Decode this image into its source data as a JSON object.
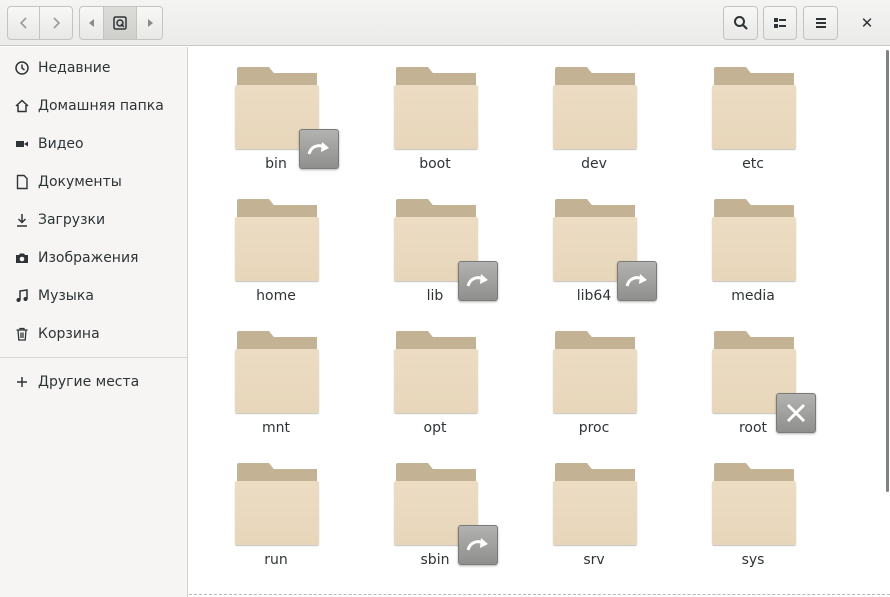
{
  "header": {
    "back_icon": "chevron-left-icon",
    "forward_icon": "chevron-right-icon",
    "path_prev_icon": "triangle-left-icon",
    "path_root_icon": "drive-icon",
    "path_next_icon": "triangle-right-icon",
    "search_icon": "search-icon",
    "view_icon": "list-view-icon",
    "menu_icon": "hamburger-menu-icon",
    "close_label": "✕"
  },
  "sidebar": {
    "items": [
      {
        "label": "Недавние",
        "icon": "clock-icon"
      },
      {
        "label": "Домашняя папка",
        "icon": "home-icon"
      },
      {
        "label": "Видео",
        "icon": "video-icon"
      },
      {
        "label": "Документы",
        "icon": "document-icon"
      },
      {
        "label": "Загрузки",
        "icon": "download-icon"
      },
      {
        "label": "Изображения",
        "icon": "camera-icon"
      },
      {
        "label": "Музыка",
        "icon": "music-icon"
      },
      {
        "label": "Корзина",
        "icon": "trash-icon"
      }
    ],
    "other": {
      "label": "Другие места",
      "icon": "plus-icon"
    }
  },
  "folders": [
    {
      "name": "bin",
      "emblem": "symlink"
    },
    {
      "name": "boot",
      "emblem": ""
    },
    {
      "name": "dev",
      "emblem": ""
    },
    {
      "name": "etc",
      "emblem": ""
    },
    {
      "name": "home",
      "emblem": ""
    },
    {
      "name": "lib",
      "emblem": "symlink"
    },
    {
      "name": "lib64",
      "emblem": "symlink"
    },
    {
      "name": "media",
      "emblem": ""
    },
    {
      "name": "mnt",
      "emblem": ""
    },
    {
      "name": "opt",
      "emblem": ""
    },
    {
      "name": "proc",
      "emblem": ""
    },
    {
      "name": "root",
      "emblem": "unreadable"
    },
    {
      "name": "run",
      "emblem": ""
    },
    {
      "name": "sbin",
      "emblem": "symlink"
    },
    {
      "name": "srv",
      "emblem": ""
    },
    {
      "name": "sys",
      "emblem": ""
    }
  ]
}
